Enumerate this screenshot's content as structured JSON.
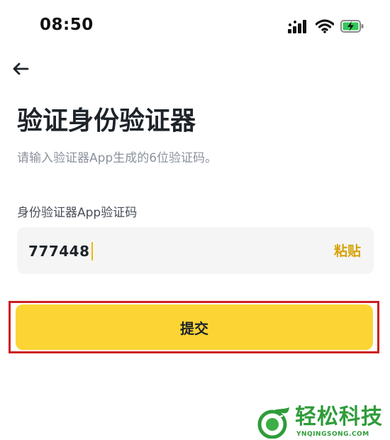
{
  "status_bar": {
    "time": "08:50",
    "icons": [
      "cellular-signal-icon",
      "wifi-icon",
      "battery-charging-icon"
    ]
  },
  "header": {
    "back_icon": "back-arrow-icon"
  },
  "page": {
    "title": "验证身份验证器",
    "subtitle": "请输入验证器App生成的6位验证码。"
  },
  "form": {
    "field_label": "身份验证器App验证码",
    "code_value": "777448",
    "paste_label": "粘贴",
    "submit_label": "提交"
  },
  "watermark": {
    "title": "轻松科技",
    "url": "YNQINGSONG.COM"
  },
  "colors": {
    "accent_yellow": "#fcd535",
    "paste_text": "#d7a20a",
    "highlight_border": "#cc1f1f",
    "watermark_green": "#2f9c3a"
  }
}
